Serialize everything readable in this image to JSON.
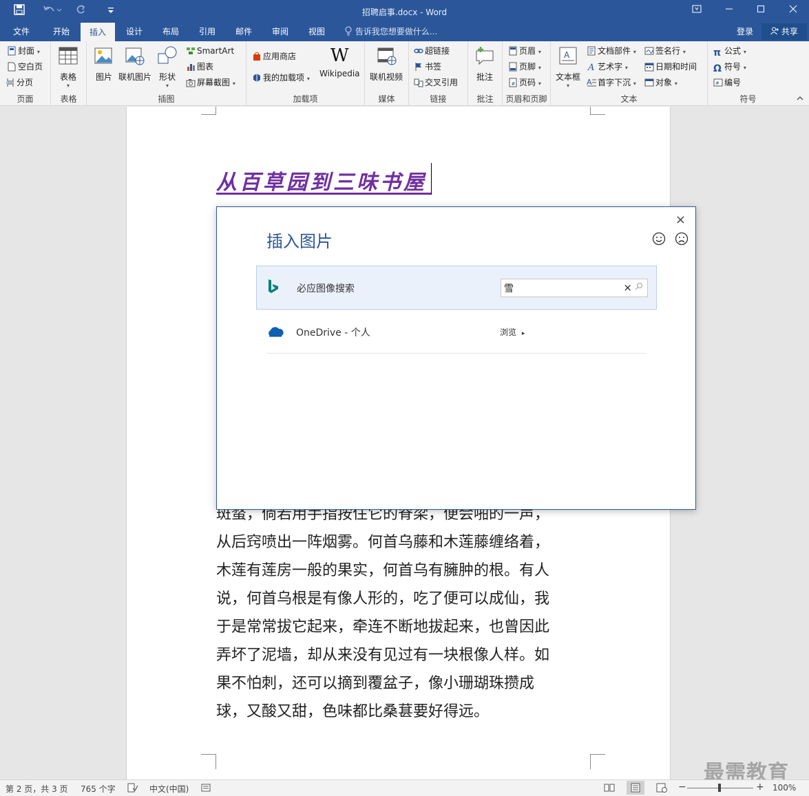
{
  "titlebar": {
    "title": "招聘启事.docx - Word",
    "save_icon": "save-icon",
    "undo_icon": "undo-icon",
    "redo_icon": "redo-icon",
    "customize_icon": "customize-icon"
  },
  "tabs": [
    "文件",
    "开始",
    "插入",
    "设计",
    "布局",
    "引用",
    "邮件",
    "审阅",
    "视图"
  ],
  "active_tab": "插入",
  "tellme": "告诉我您想要做什么...",
  "account": {
    "login": "登录",
    "share": "共享"
  },
  "ribbon": {
    "pages": {
      "label": "页面",
      "cover": "封面",
      "blank": "空白页",
      "break": "分页"
    },
    "tables": {
      "label": "表格",
      "table": "表格"
    },
    "illustrations": {
      "label": "插图",
      "picture": "图片",
      "online_picture": "联机图片",
      "shapes": "形状",
      "smartart": "SmartArt",
      "chart": "图表",
      "screenshot": "屏幕截图"
    },
    "addins": {
      "label": "加载项",
      "store": "应用商店",
      "my_addins": "我的加载项",
      "wikipedia": "Wikipedia"
    },
    "media": {
      "label": "媒体",
      "online_video": "联机视频"
    },
    "links": {
      "label": "链接",
      "hyperlink": "超链接",
      "bookmark": "书签",
      "crossref": "交叉引用"
    },
    "comments": {
      "label": "批注",
      "comment": "批注"
    },
    "header_footer": {
      "label": "页眉和页脚",
      "header": "页眉",
      "footer": "页脚",
      "page_number": "页码"
    },
    "text": {
      "label": "文本",
      "textbox": "文本框",
      "quick_parts": "文档部件",
      "wordart": "艺术字",
      "dropcap": "首字下沉",
      "signature": "签名行",
      "datetime": "日期和时间",
      "object": "对象"
    },
    "symbols": {
      "label": "符号",
      "equation": "公式",
      "symbol": "符号",
      "numbering": "编号"
    }
  },
  "document": {
    "title": "从百草园到三味书屋",
    "paragraph_lines": [
      "斑蝥，倘若用手指按住它的脊梁，便会啪的一声，",
      "从后窍喷出一阵烟雾。何首乌藤和木莲藤缠络着，",
      "木莲有莲房一般的果实，何首乌有臃肿的根。有人",
      "说，何首乌根是有像人形的，吃了便可以成仙，我",
      "于是常常拔它起来，牵连不断地拔起来，也曾因此",
      "弄坏了泥墙，却从来没有见过有一块根像人样。如",
      "果不怕刺，还可以摘到覆盆子，像小珊瑚珠攒成",
      "球，又酸又甜，色味都比桑葚要好得远。"
    ]
  },
  "dialog": {
    "title": "插入图片",
    "close": "×",
    "bing_label": "必应图像搜索",
    "search_value": "雪",
    "clear": "×",
    "onedrive_label": "OneDrive - 个人",
    "browse": "浏览"
  },
  "watermark": "最需教育",
  "status": {
    "page": "第 2 页，共 3 页",
    "words": "765 个字",
    "language": "中文(中国)",
    "zoom": "100%",
    "zoom_level_percent": 100
  },
  "colors": {
    "accent": "#2b579a",
    "title_purple": "#7030a0",
    "bing_green": "#008373",
    "onedrive_blue": "#0f5fb3"
  }
}
